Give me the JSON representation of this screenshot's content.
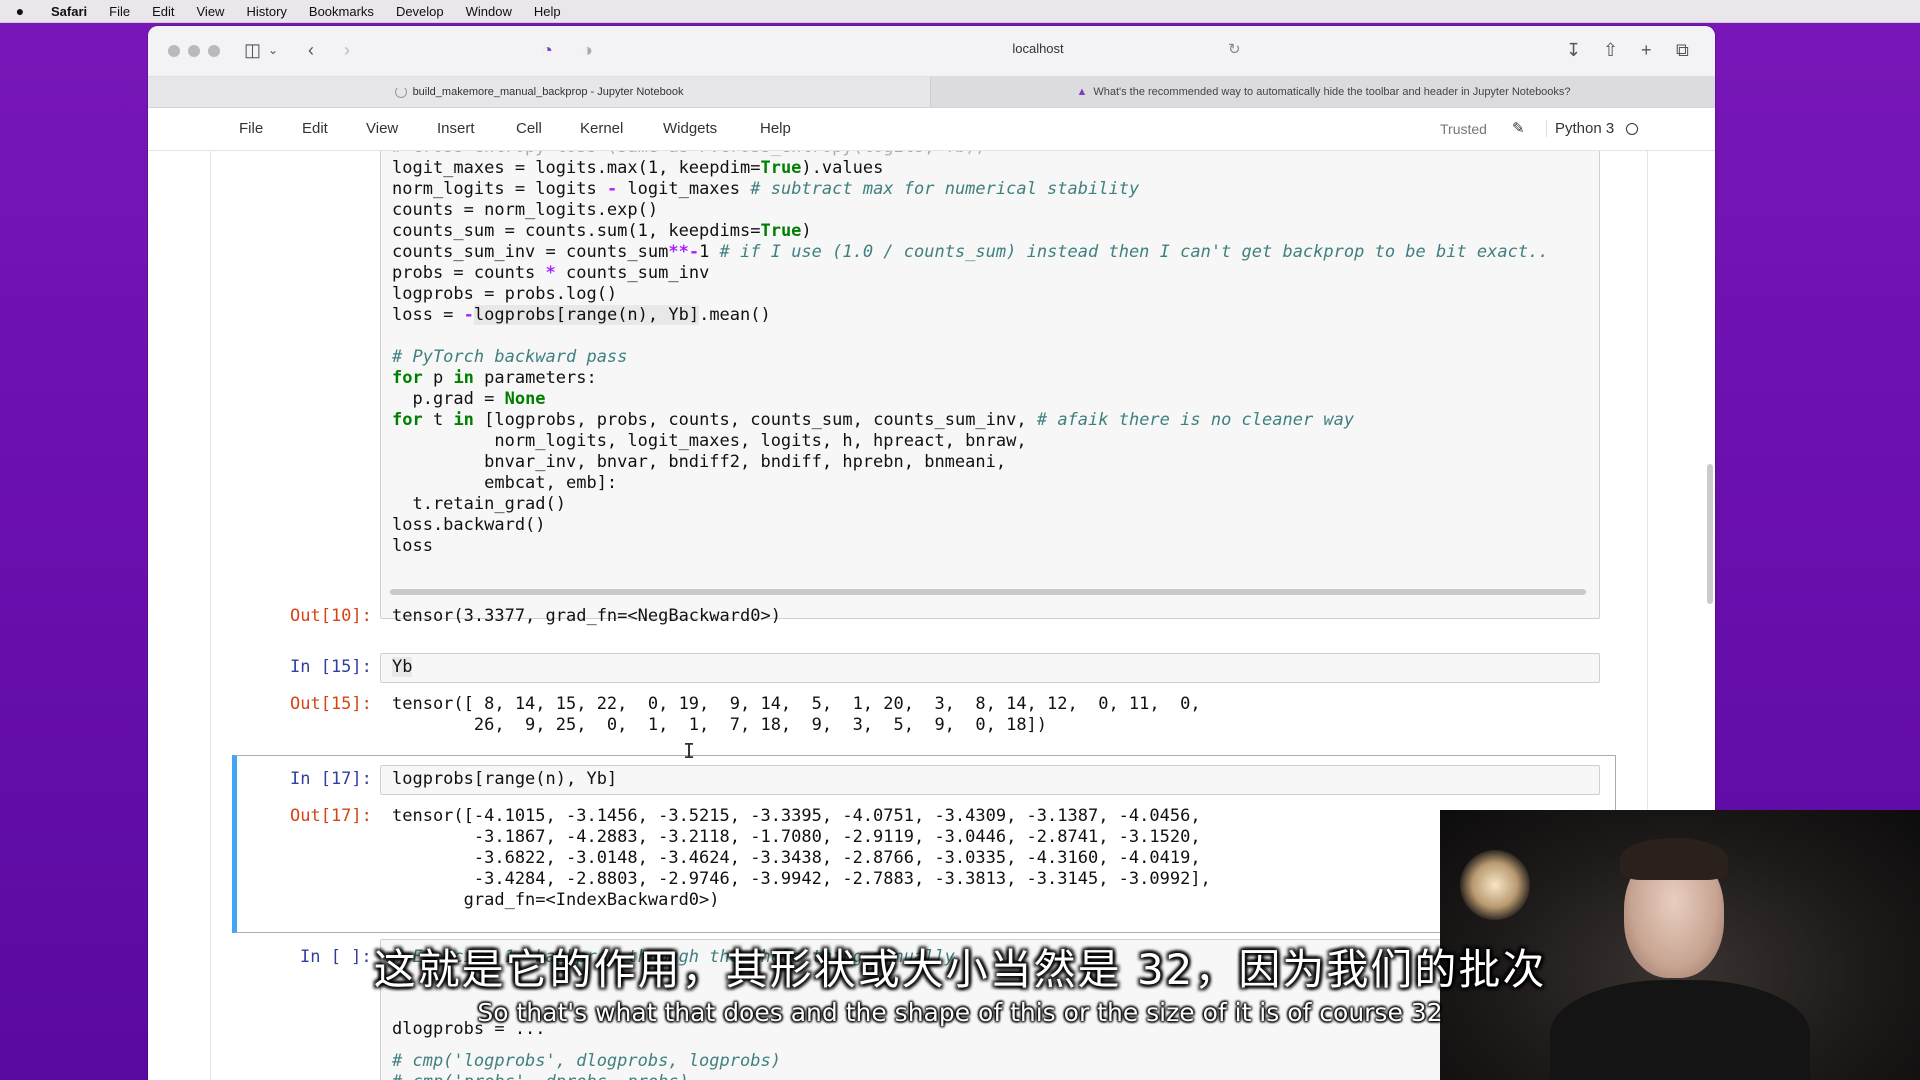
{
  "menubar": {
    "apple": "",
    "items": [
      "Safari",
      "File",
      "Edit",
      "View",
      "History",
      "Bookmarks",
      "Develop",
      "Window",
      "Help"
    ]
  },
  "browser": {
    "address": "localhost",
    "tabs": [
      {
        "title": "build_makemore_manual_backprop - Jupyter Notebook"
      },
      {
        "title": "What's the recommended way to automatically hide the toolbar and header in Jupyter Notebooks?"
      }
    ]
  },
  "jupyter": {
    "menu": [
      "File",
      "Edit",
      "View",
      "Insert",
      "Cell",
      "Kernel",
      "Widgets",
      "Help"
    ],
    "trusted": "Trusted",
    "kernel": "Python 3"
  },
  "cells": {
    "c10_out_prompt": "Out[10]:",
    "c10_out": "tensor(3.3377, grad_fn=<NegBackward0>)",
    "c15_in_prompt": "In [15]:",
    "c15_in": "Yb",
    "c15_out_prompt": "Out[15]:",
    "c15_out_1": "tensor([ 8, 14, 15, 22,  0, 19,  9, 14,  5,  1, 20,  3,  8, 14, 12,  0, 11,  0,",
    "c15_out_2": "        26,  9, 25,  0,  1,  1,  7, 18,  9,  3,  5,  9,  0, 18])",
    "c17_in_prompt": "In [17]:",
    "c17_in": "logprobs[range(n), Yb]",
    "c17_out_prompt": "Out[17]:",
    "c17_out_1": "tensor([-4.1015, -3.1456, -3.5215, -3.3395, -4.0751, -3.4309, -3.1387, -4.0456,",
    "c17_out_2": "        -3.1867, -4.2883, -3.2118, -1.7080, -2.9119, -3.0446, -2.8741, -3.1520,",
    "c17_out_3": "        -3.6822, -3.0148, -3.4624, -3.3438, -2.8766, -3.0335, -4.3160, -4.0419,",
    "c17_out_4": "        -3.4284, -2.8803, -2.9746, -3.9942, -2.7883, -3.3813, -3.3145, -3.0992],",
    "c17_out_5": "       grad_fn=<IndexBackward0>)",
    "next_in_prompt": "In [ ]:",
    "next_line_1": "# Exercise 1: backprop through the whole thing manually,",
    "next_line_2": "dlogprobs = ...",
    "next_line_3": "# cmp('logprobs', dlogprobs, logprobs)",
    "next_line_4": "# cmp('probs', dprobs, probs)"
  },
  "subtitles": {
    "chinese": "这就是它的作用，其形状或大小当然是 32，因为我们的批次",
    "english": "So that's what that does and the shape of this or the size of it is of course 32"
  }
}
